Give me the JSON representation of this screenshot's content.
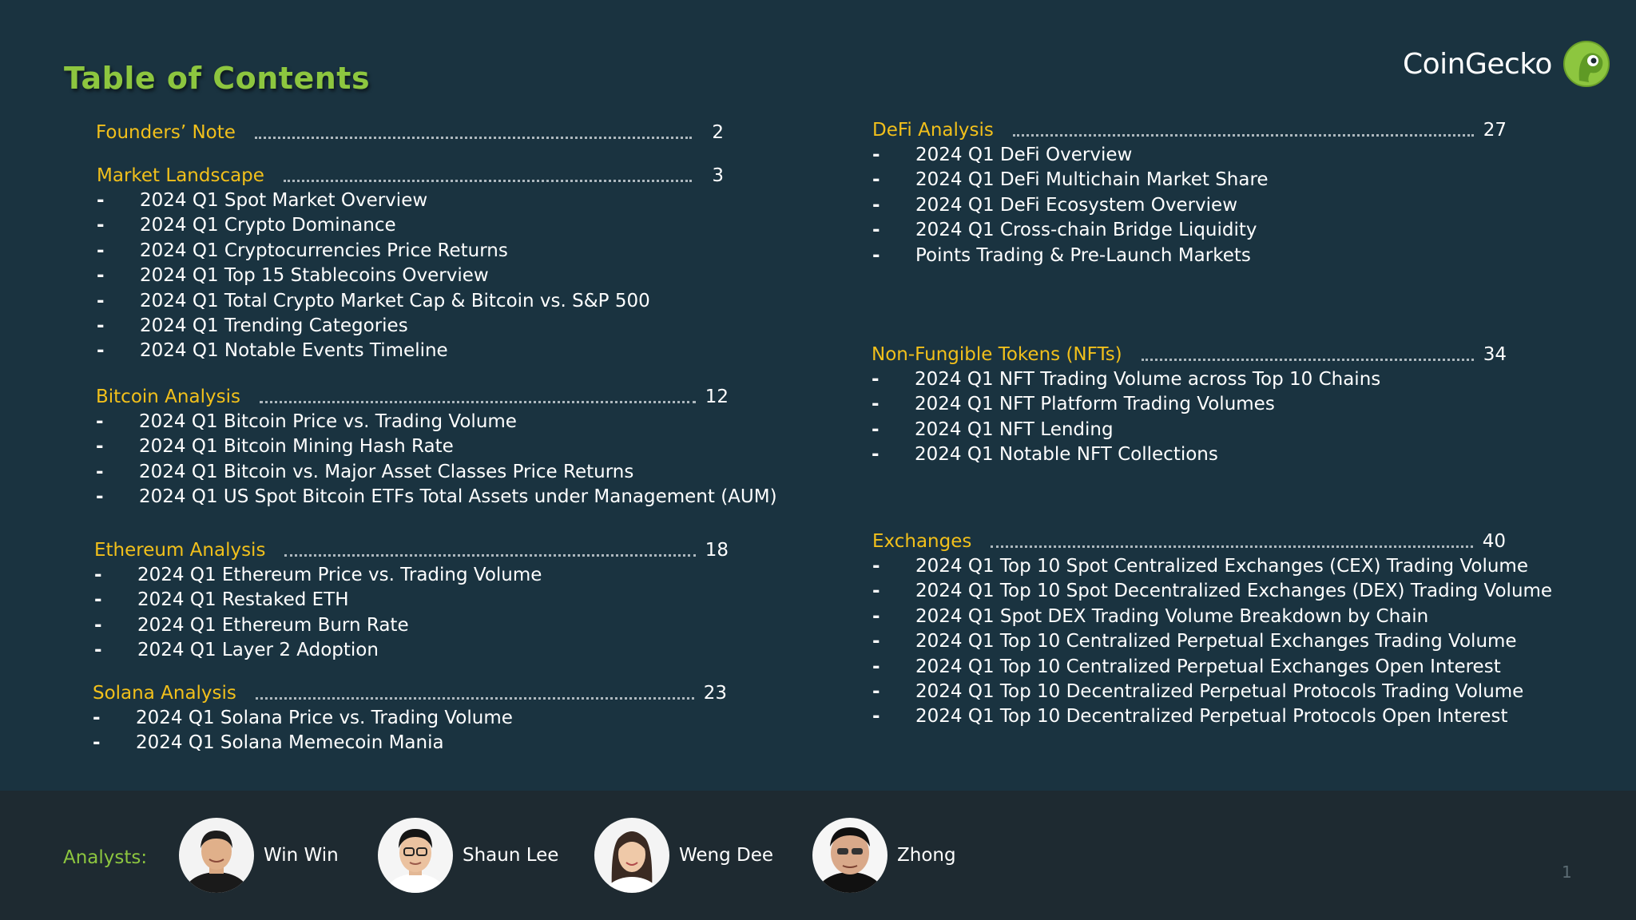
{
  "title": "Table of Contents",
  "brand": {
    "name": "CoinGecko",
    "accent": "#8dc63f",
    "highlight": "#f2c01b",
    "background": "#1a3340"
  },
  "left_sections": [
    {
      "title": "Founders’ Note",
      "page": "2",
      "items": []
    },
    {
      "title": "Market Landscape",
      "page": "3",
      "items": [
        "2024 Q1 Spot Market Overview",
        "2024 Q1 Crypto Dominance",
        "2024 Q1 Cryptocurrencies Price Returns",
        "2024 Q1 Top 15 Stablecoins Overview",
        "2024 Q1 Total Crypto Market Cap & Bitcoin vs. S&P 500",
        "2024 Q1 Trending Categories",
        "2024 Q1 Notable Events Timeline"
      ]
    },
    {
      "title": "Bitcoin Analysis",
      "page": "12",
      "items": [
        "2024 Q1 Bitcoin Price vs. Trading Volume",
        "2024 Q1 Bitcoin Mining Hash Rate",
        "2024 Q1 Bitcoin vs. Major Asset Classes Price Returns",
        "2024 Q1 US Spot Bitcoin ETFs Total Assets under Management (AUM)"
      ]
    },
    {
      "title": "Ethereum Analysis",
      "page": "18",
      "items": [
        "2024 Q1 Ethereum Price vs. Trading Volume",
        "2024 Q1 Restaked ETH",
        "2024 Q1 Ethereum Burn Rate",
        "2024 Q1 Layer 2 Adoption"
      ]
    },
    {
      "title": "Solana Analysis",
      "page": "23",
      "items": [
        "2024 Q1 Solana Price vs. Trading Volume",
        "2024 Q1 Solana Memecoin Mania"
      ]
    }
  ],
  "right_sections": [
    {
      "title": "DeFi Analysis",
      "page": "27",
      "items": [
        "2024 Q1 DeFi Overview",
        "2024 Q1 DeFi Multichain Market Share",
        "2024 Q1 DeFi Ecosystem Overview",
        "2024 Q1 Cross-chain Bridge Liquidity",
        "Points Trading & Pre-Launch Markets"
      ]
    },
    {
      "title": "Non-Fungible Tokens (NFTs)",
      "page": "34",
      "items": [
        "2024 Q1 NFT Trading Volume across Top 10 Chains",
        "2024 Q1 NFT Platform Trading Volumes",
        "2024 Q1 NFT Lending",
        "2024 Q1 Notable NFT Collections"
      ]
    },
    {
      "title": "Exchanges",
      "page": "40",
      "items": [
        "2024 Q1 Top 10 Spot Centralized Exchanges (CEX) Trading Volume",
        "2024 Q1 Top 10 Spot Decentralized Exchanges (DEX) Trading Volume",
        "2024 Q1 Spot DEX Trading Volume Breakdown by Chain",
        "2024 Q1 Top 10 Centralized Perpetual Exchanges Trading Volume",
        "2024 Q1 Top 10 Centralized Perpetual Exchanges Open Interest",
        "2024 Q1 Top 10 Decentralized Perpetual Protocols Trading Volume",
        "2024 Q1 Top 10 Decentralized Perpetual Protocols Open Interest"
      ]
    }
  ],
  "footer": {
    "label": "Analysts:",
    "analysts": [
      "Win Win",
      "Shaun Lee",
      "Weng Dee",
      "Zhong"
    ],
    "slide_number": "1"
  }
}
